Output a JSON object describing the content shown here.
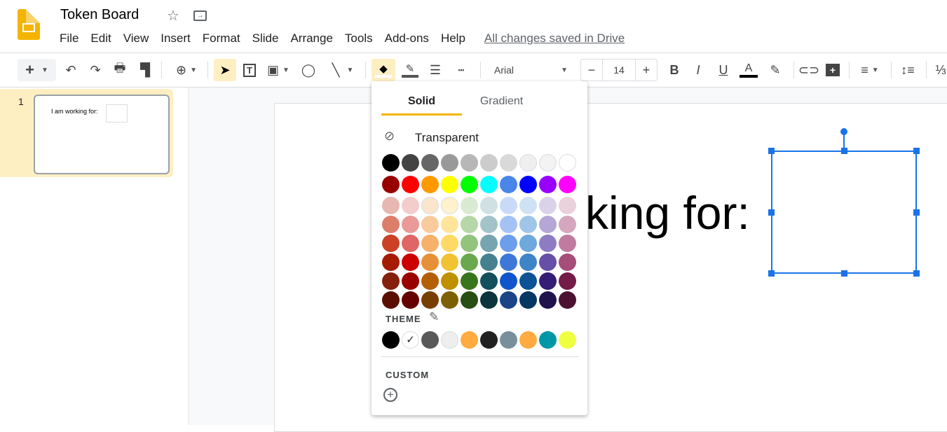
{
  "app": {
    "title": "Token Board",
    "star_icon": "star-icon",
    "move_icon": "move-to-folder-icon"
  },
  "menu": [
    "File",
    "Edit",
    "View",
    "Insert",
    "Format",
    "Slide",
    "Arrange",
    "Tools",
    "Add-ons",
    "Help"
  ],
  "save_status": "All changes saved in Drive",
  "toolbar": {
    "font": "Arial",
    "font_size": "14",
    "text_color": "#000000"
  },
  "filmstrip": {
    "slides": [
      {
        "number": "1",
        "text": "I am working for:"
      }
    ]
  },
  "slide": {
    "text": "I am working for:"
  },
  "fill_popup": {
    "tabs": [
      "Solid",
      "Gradient"
    ],
    "active_tab": "Solid",
    "transparent_label": "Transparent",
    "palette": [
      [
        "#000000",
        "#434343",
        "#666666",
        "#999999",
        "#b7b7b7",
        "#cccccc",
        "#d9d9d9",
        "#efefef",
        "#f3f3f3",
        "#ffffff"
      ],
      [
        "#980000",
        "#ff0000",
        "#ff9900",
        "#ffff00",
        "#00ff00",
        "#00ffff",
        "#4a86e8",
        "#0000ff",
        "#9900ff",
        "#ff00ff"
      ],
      [
        "#e6b8af",
        "#f4cccc",
        "#fce5cd",
        "#fff2cc",
        "#d9ead3",
        "#d0e0e3",
        "#c9daf8",
        "#cfe2f3",
        "#d9d2e9",
        "#ead1dc"
      ],
      [
        "#dd7e6b",
        "#ea9999",
        "#f9cb9c",
        "#ffe599",
        "#b6d7a8",
        "#a2c4c9",
        "#a4c2f4",
        "#9fc5e8",
        "#b4a7d6",
        "#d5a6bd"
      ],
      [
        "#cc4125",
        "#e06666",
        "#f6b26b",
        "#ffd966",
        "#93c47d",
        "#76a5af",
        "#6d9eeb",
        "#6fa8dc",
        "#8e7cc3",
        "#c27ba0"
      ],
      [
        "#a61c00",
        "#cc0000",
        "#e69138",
        "#f1c232",
        "#6aa84f",
        "#45818e",
        "#3c78d8",
        "#3d85c6",
        "#674ea7",
        "#a64d79"
      ],
      [
        "#85200c",
        "#990000",
        "#b45f06",
        "#bf9000",
        "#38761d",
        "#134f5c",
        "#1155cc",
        "#0b5394",
        "#351c75",
        "#741b47"
      ],
      [
        "#5b0f00",
        "#660000",
        "#783f04",
        "#7f6000",
        "#274e13",
        "#0c343d",
        "#1c4587",
        "#073763",
        "#20124d",
        "#4c1130"
      ]
    ],
    "theme_label": "THEME",
    "theme": [
      "#000000",
      "#ffffff",
      "#595959",
      "#eeeeee",
      "#ffab40",
      "#212121",
      "#78909c",
      "#ffab40",
      "#0097a7",
      "#eeff41"
    ],
    "theme_selected": "#ffffff",
    "custom_label": "CUSTOM"
  }
}
